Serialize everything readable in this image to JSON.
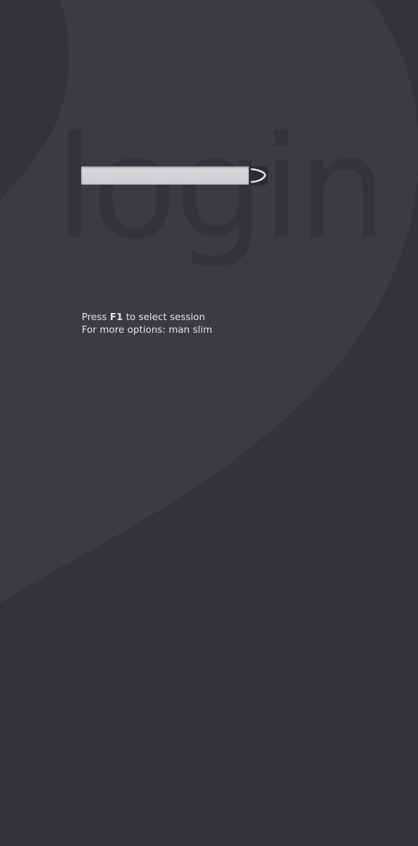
{
  "screen": {
    "watermark_text": "login",
    "username_field": {
      "value": "",
      "placeholder": ""
    },
    "submit_icon": "arrow-swoosh-icon",
    "hints": {
      "line1_prefix": "Press ",
      "line1_key": "F1",
      "line1_suffix": " to select session",
      "line2": "For more options: man slim"
    }
  },
  "colors": {
    "background_dark": "#34323d",
    "background_light": "#3c3a45",
    "field_fill": "#d4d4d8",
    "button_fill": "#2c2a33",
    "hint_text": "#e6e5ea"
  }
}
